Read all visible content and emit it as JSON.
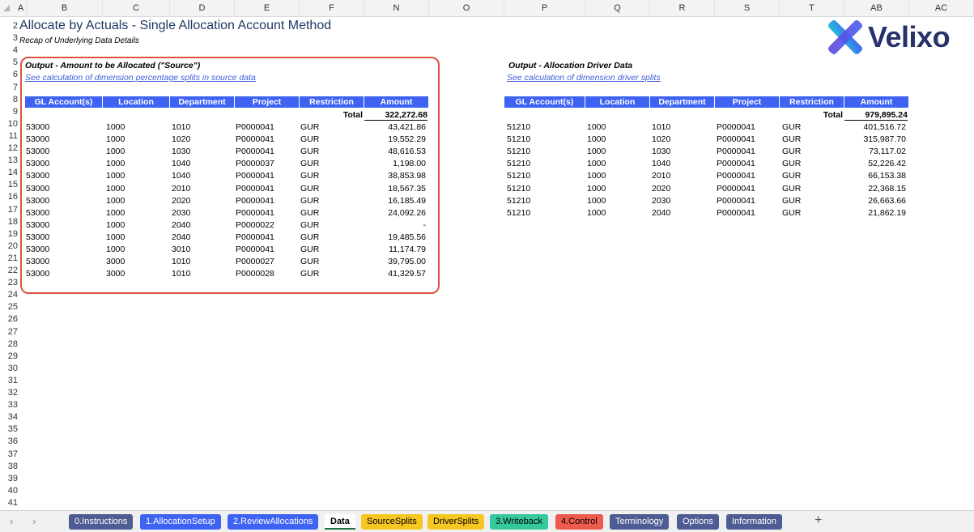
{
  "columns": [
    "A",
    "B",
    "C",
    "D",
    "E",
    "F",
    "N",
    "O",
    "P",
    "Q",
    "R",
    "S",
    "T",
    "AB",
    "AC"
  ],
  "rows": [
    "2",
    "3",
    "4",
    "5",
    "6",
    "7",
    "8",
    "9",
    "10",
    "11",
    "12",
    "13",
    "14",
    "15",
    "16",
    "17",
    "18",
    "19",
    "20",
    "21",
    "22",
    "23",
    "24",
    "25",
    "26",
    "27",
    "28",
    "29",
    "30",
    "31",
    "32",
    "33",
    "34",
    "35",
    "36",
    "37",
    "38",
    "39",
    "40",
    "41"
  ],
  "title": "Allocate by Actuals - Single Allocation Account Method",
  "subtitle": "Recap of Underlying Data Details",
  "logo": {
    "text": "Velixo"
  },
  "source": {
    "heading": "Output - Amount to be Allocated (\"Source\")",
    "link": "See calculation of dimension percentage splits in source data",
    "headers": [
      "GL Account(s)",
      "Location",
      "Department",
      "Project",
      "Restriction",
      "Amount"
    ],
    "total_label": "Total",
    "total": "322,272.68",
    "rows": [
      [
        "53000",
        "1000",
        "1010",
        "P0000041",
        "GUR",
        "43,421.86"
      ],
      [
        "53000",
        "1000",
        "1020",
        "P0000041",
        "GUR",
        "19,552.29"
      ],
      [
        "53000",
        "1000",
        "1030",
        "P0000041",
        "GUR",
        "48,616.53"
      ],
      [
        "53000",
        "1000",
        "1040",
        "P0000037",
        "GUR",
        "1,198.00"
      ],
      [
        "53000",
        "1000",
        "1040",
        "P0000041",
        "GUR",
        "38,853.98"
      ],
      [
        "53000",
        "1000",
        "2010",
        "P0000041",
        "GUR",
        "18,567.35"
      ],
      [
        "53000",
        "1000",
        "2020",
        "P0000041",
        "GUR",
        "16,185.49"
      ],
      [
        "53000",
        "1000",
        "2030",
        "P0000041",
        "GUR",
        "24,092.26"
      ],
      [
        "53000",
        "1000",
        "2040",
        "P0000022",
        "GUR",
        "-"
      ],
      [
        "53000",
        "1000",
        "2040",
        "P0000041",
        "GUR",
        "19,485.56"
      ],
      [
        "53000",
        "1000",
        "3010",
        "P0000041",
        "GUR",
        "11,174.79"
      ],
      [
        "53000",
        "3000",
        "1010",
        "P0000027",
        "GUR",
        "39,795.00"
      ],
      [
        "53000",
        "3000",
        "1010",
        "P0000028",
        "GUR",
        "41,329.57"
      ]
    ]
  },
  "driver": {
    "heading": "Output - Allocation Driver Data",
    "link": "See calculation of dimension driver splits",
    "headers": [
      "GL Account(s)",
      "Location",
      "Department",
      "Project",
      "Restriction",
      "Amount"
    ],
    "total_label": "Total",
    "total": "979,895.24",
    "rows": [
      [
        "51210",
        "1000",
        "1010",
        "P0000041",
        "GUR",
        "401,516.72"
      ],
      [
        "51210",
        "1000",
        "1020",
        "P0000041",
        "GUR",
        "315,987.70"
      ],
      [
        "51210",
        "1000",
        "1030",
        "P0000041",
        "GUR",
        "73,117.02"
      ],
      [
        "51210",
        "1000",
        "1040",
        "P0000041",
        "GUR",
        "52,226.42"
      ],
      [
        "51210",
        "1000",
        "2010",
        "P0000041",
        "GUR",
        "66,153.38"
      ],
      [
        "51210",
        "1000",
        "2020",
        "P0000041",
        "GUR",
        "22,368.15"
      ],
      [
        "51210",
        "1000",
        "2030",
        "P0000041",
        "GUR",
        "26,663.66"
      ],
      [
        "51210",
        "1000",
        "2040",
        "P0000041",
        "GUR",
        "21,862.19"
      ]
    ]
  },
  "tabs": [
    {
      "label": "0.Instructions",
      "bg": "#4f5b93",
      "fg": "#ffffff"
    },
    {
      "label": "1.AllocationSetup",
      "bg": "#3e63f2",
      "fg": "#ffffff"
    },
    {
      "label": "2.ReviewAllocations",
      "bg": "#3e63f2",
      "fg": "#ffffff"
    },
    {
      "label": "Data",
      "bg": "#ffffff",
      "fg": "#000000",
      "active": true
    },
    {
      "label": "SourceSplits",
      "bg": "#f6c721",
      "fg": "#000000"
    },
    {
      "label": "DriverSplits",
      "bg": "#f6c721",
      "fg": "#000000"
    },
    {
      "label": "3.Writeback",
      "bg": "#36c9a0",
      "fg": "#000000"
    },
    {
      "label": "4.Control",
      "bg": "#ee5a4e",
      "fg": "#000000"
    },
    {
      "label": "Terminology",
      "bg": "#4f5b93",
      "fg": "#ffffff"
    },
    {
      "label": "Options",
      "bg": "#4f5b93",
      "fg": "#ffffff"
    },
    {
      "label": "Information",
      "bg": "#4f5b93",
      "fg": "#ffffff"
    }
  ],
  "add_sheet": "+",
  "nav": {
    "prev": "‹",
    "next": "›"
  }
}
